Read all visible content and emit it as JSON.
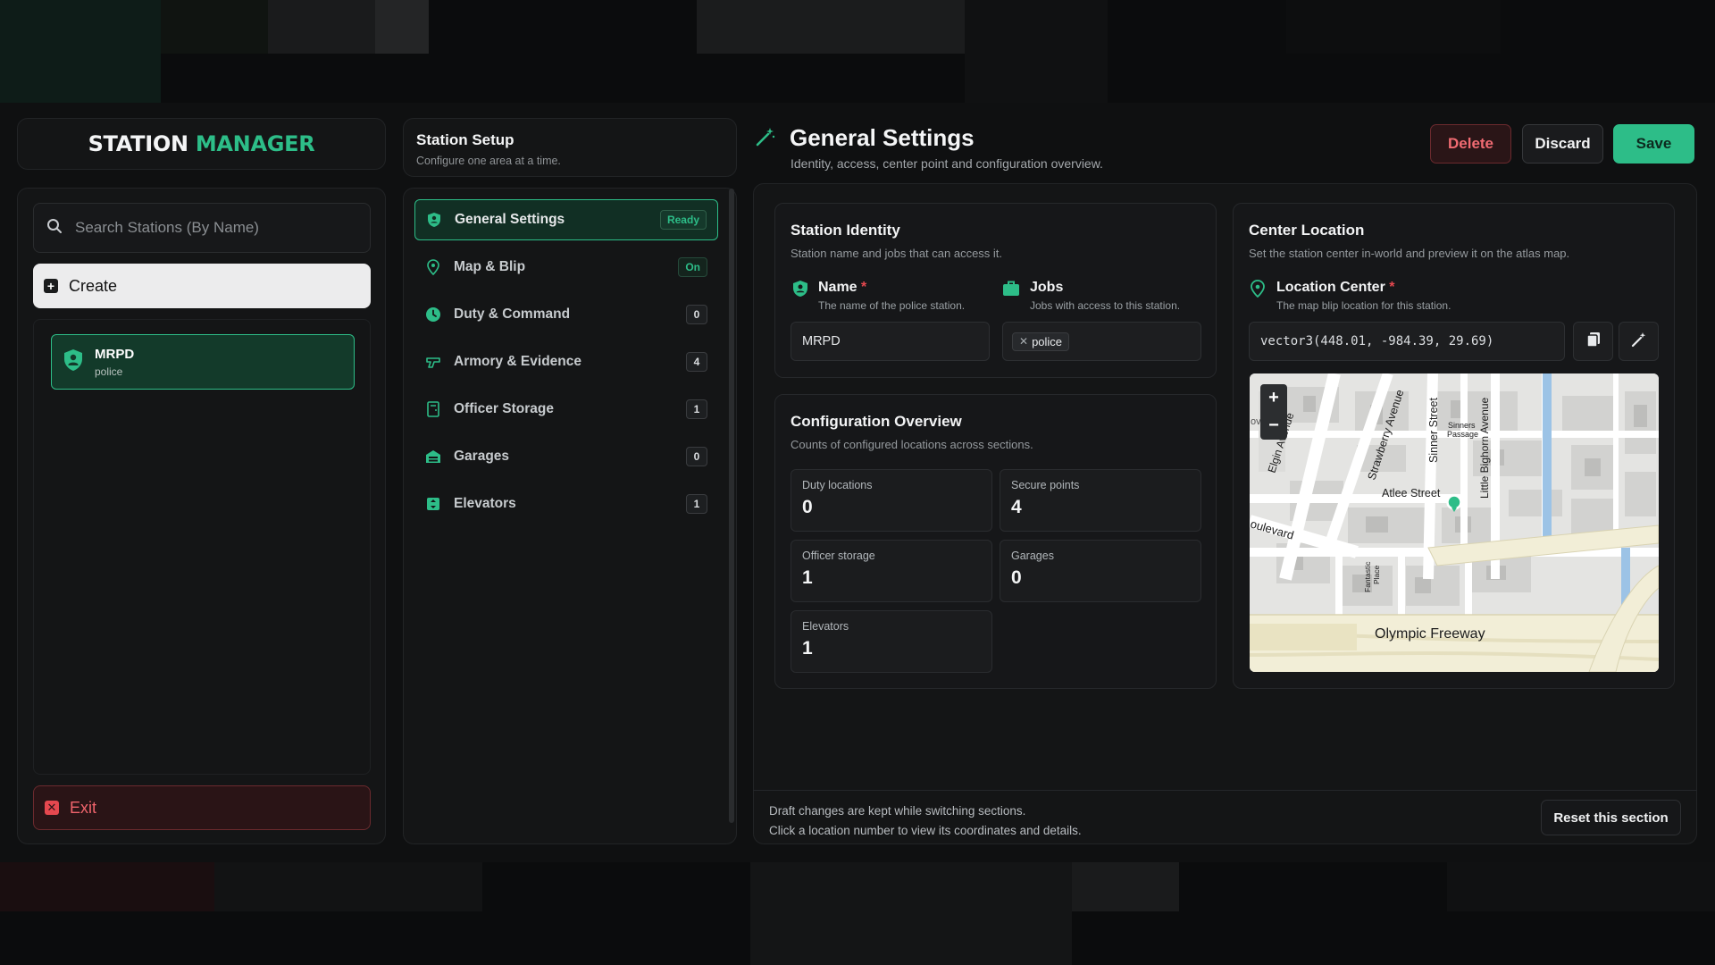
{
  "brand": {
    "word1": "STATION",
    "word2": "MANAGER"
  },
  "sidebar": {
    "search_placeholder": "Search Stations (By Name)",
    "create_label": "Create",
    "stations": [
      {
        "name": "MRPD",
        "job": "police"
      }
    ],
    "exit_label": "Exit"
  },
  "setup": {
    "title": "Station Setup",
    "subtitle": "Configure one area at a time.",
    "items": [
      {
        "label": "General Settings",
        "badge": "Ready",
        "icon": "shield-icon"
      },
      {
        "label": "Map & Blip",
        "badge": "On",
        "icon": "pin-icon"
      },
      {
        "label": "Duty & Command",
        "badge": "0",
        "icon": "clock-icon"
      },
      {
        "label": "Armory & Evidence",
        "badge": "4",
        "icon": "gun-icon"
      },
      {
        "label": "Officer Storage",
        "badge": "1",
        "icon": "locker-icon"
      },
      {
        "label": "Garages",
        "badge": "0",
        "icon": "garage-icon"
      },
      {
        "label": "Elevators",
        "badge": "1",
        "icon": "elevator-icon"
      }
    ]
  },
  "header": {
    "title": "General Settings",
    "subtitle": "Identity, access, center point and configuration overview.",
    "delete_label": "Delete",
    "discard_label": "Discard",
    "save_label": "Save"
  },
  "identity": {
    "title": "Station Identity",
    "subtitle": "Station name and jobs that can access it.",
    "name_label": "Name",
    "name_required": "*",
    "name_hint": "The name of the police station.",
    "name_value": "MRPD",
    "jobs_label": "Jobs",
    "jobs_hint": "Jobs with access to this station.",
    "jobs": [
      "police"
    ]
  },
  "overview": {
    "title": "Configuration Overview",
    "subtitle": "Counts of configured locations across sections.",
    "stats": [
      {
        "label": "Duty locations",
        "value": "0"
      },
      {
        "label": "Secure points",
        "value": "4"
      },
      {
        "label": "Officer storage",
        "value": "1"
      },
      {
        "label": "Garages",
        "value": "0"
      },
      {
        "label": "Elevators",
        "value": "1"
      }
    ]
  },
  "center": {
    "title": "Center Location",
    "subtitle": "Set the station center in-world and preview it on the atlas map.",
    "field_label": "Location Center",
    "field_required": "*",
    "field_hint": "The map blip location for this station.",
    "value": "vector3(448.01, -984.39, 29.69)"
  },
  "map": {
    "zoom_in": "+",
    "zoom_out": "−",
    "labels": {
      "strawberry": "Strawberry Avenue",
      "sinner": "Sinner Street",
      "sinners_passage_1": "Sinners",
      "sinners_passage_2": "Passage",
      "little_bighorn": "Little Bighorn Avenue",
      "elgin": "Elgin Avenue",
      "boulevard": "oulevard",
      "atlee": "Atlee Street",
      "fantastic": "Fantastic",
      "place": "Place",
      "freeway": "Olympic Freeway",
      "edge": "ov"
    }
  },
  "footer": {
    "line1": "Draft changes are kept while switching sections.",
    "line2": "Click a location number to view its coordinates and details.",
    "reset_label": "Reset this section"
  },
  "colors": {
    "accent": "#2dbd88",
    "danger": "#e5484f",
    "background": "#0f1011"
  }
}
